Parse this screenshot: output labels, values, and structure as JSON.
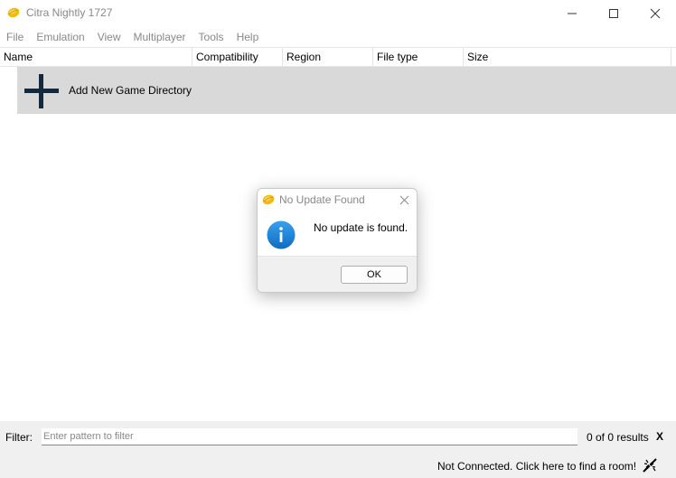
{
  "window": {
    "title": "Citra Nightly 1727",
    "icon": "citra-logo-icon",
    "controls": [
      "minimize-icon",
      "maximize-icon",
      "close-icon"
    ]
  },
  "menu": [
    "File",
    "Emulation",
    "View",
    "Multiplayer",
    "Tools",
    "Help"
  ],
  "game_list": {
    "columns": [
      "Name",
      "Compatibility",
      "Region",
      "File type",
      "Size"
    ],
    "add_directory_label": "Add New Game Directory",
    "add_directory_icon": "plus-icon"
  },
  "dialog": {
    "title": "No Update Found",
    "icon": "info-icon",
    "message": "No update is found.",
    "ok_label": "OK",
    "info_color": "#1a7fd4"
  },
  "filter": {
    "label": "Filter:",
    "placeholder": "Enter pattern to filter",
    "value": "",
    "results": "0 of 0 results",
    "clear_label": "X"
  },
  "status": {
    "text": "Not Connected. Click here to find a room!",
    "icon": "disconnected-icon"
  }
}
